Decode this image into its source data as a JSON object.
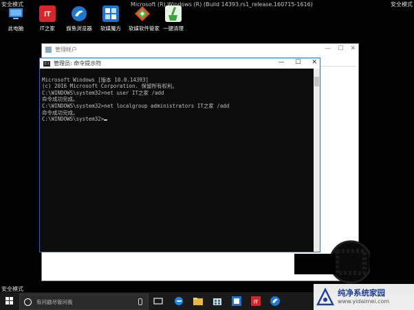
{
  "top_bar": {
    "safe_mode_left": "安全模式",
    "safe_mode_right": "安全模式",
    "build_text": "Microsoft (R) Windows (R) (Build 14393.rs1_release.160715-1616)"
  },
  "desktop_icons": [
    {
      "label": "此电脑",
      "icon": "computer-icon",
      "color": "#2a7fd4"
    },
    {
      "label": "IT之家",
      "icon": "ithome-icon",
      "color": "#d6262c"
    },
    {
      "label": "旗鱼浏览器",
      "icon": "browser-icon",
      "color": "#1e78d0"
    },
    {
      "label": "软媒魔方",
      "icon": "rubik-icon",
      "color": "#1a73d9"
    },
    {
      "label": "软媒软件管家",
      "icon": "software-manager-icon",
      "color": "#e84a2a"
    },
    {
      "label": "一键清理",
      "icon": "broom-icon",
      "color": "#3aa63a"
    }
  ],
  "manager_window": {
    "title": "管理帐户",
    "minimize": "—",
    "maximize": "☐",
    "close": "✕"
  },
  "cmd_window": {
    "title": "管理员: 命令提示符",
    "minimize": "—",
    "maximize": "☐",
    "close": "✕",
    "lines": [
      "Microsoft Windows [版本 10.0.14393]",
      "(c) 2016 Microsoft Corporation. 保留所有权利。",
      "",
      "C:\\WINDOWS\\system32>net user IT之家 /add",
      "命令成功完成。",
      "",
      "",
      "C:\\WINDOWS\\system32>net localgroup administrators IT之家 /add",
      "命令成功完成。",
      "",
      "",
      "C:\\WINDOWS\\system32>"
    ]
  },
  "bottom": {
    "safe_mode": "安全模式"
  },
  "taskbar": {
    "search_placeholder": "有问题尽管问我",
    "icons": [
      "task-view-icon",
      "edge-icon",
      "file-explorer-icon",
      "store-icon",
      "rubik-icon",
      "ithome-icon",
      "browser-icon"
    ]
  },
  "watermark": {
    "title": "纯净系统家园",
    "url": "www.yidaimei.com"
  }
}
